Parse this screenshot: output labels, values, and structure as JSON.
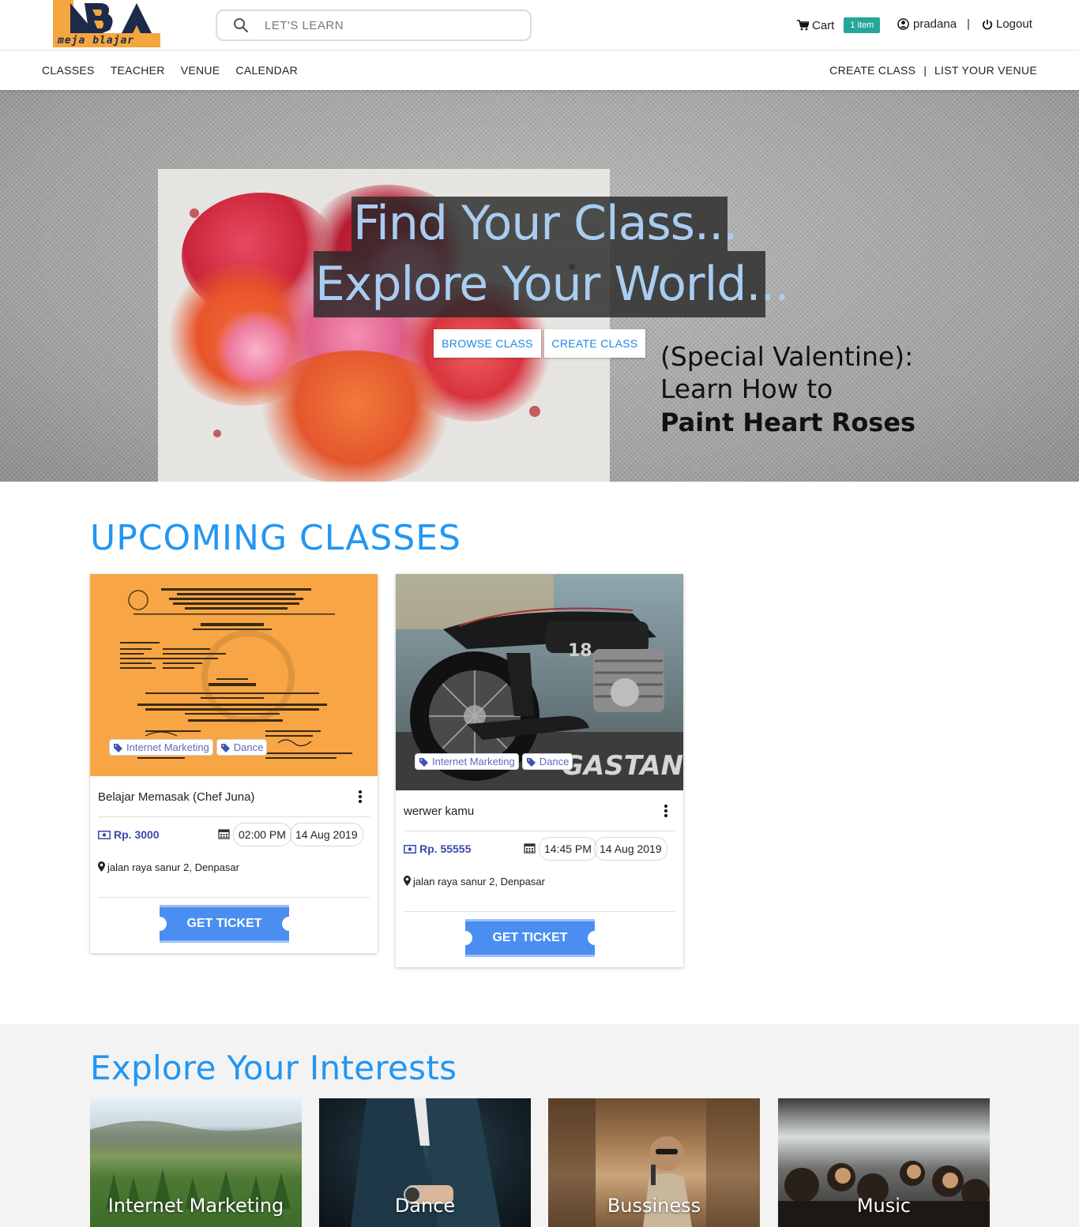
{
  "brand": {
    "logo_text": "meja blajar",
    "accent": "#f4a640",
    "navy": "#1d2a4a"
  },
  "search": {
    "placeholder": "LET'S LEARN"
  },
  "header": {
    "cart_label": "Cart",
    "cart_badge": "1 item",
    "username": "pradana",
    "separator": "|",
    "logout_label": "Logout"
  },
  "nav": {
    "left": [
      "CLASSES",
      "TEACHER",
      "VENUE",
      "CALENDAR"
    ],
    "right": [
      "CREATE CLASS",
      "LIST YOUR VENUE"
    ],
    "separator": "|"
  },
  "hero": {
    "line1": "Find Your Class...",
    "line2": "Explore Your World...",
    "browse_button": "BROWSE CLASS",
    "create_button": "CREATE CLASS",
    "promo_line1": "(Special Valentine):",
    "promo_line2": "Learn How to",
    "promo_line3": "Paint Heart Roses"
  },
  "upcoming": {
    "title": "UPCOMING CLASSES",
    "cards": [
      {
        "title": "Belajar Memasak (Chef Juna)",
        "tags": [
          "Internet Marketing",
          "Dance"
        ],
        "price": "Rp. 3000",
        "time": "02:00 PM",
        "date": "14 Aug 2019",
        "location": "jalan raya sanur 2, Denpasar",
        "button": "GET TICKET"
      },
      {
        "title": "werwer kamu",
        "tags": [
          "Internet Marketing",
          "Dance"
        ],
        "price": "Rp. 55555",
        "time": "14:45 PM",
        "date": "14 Aug 2019",
        "location": "jalan raya sanur 2, Denpasar",
        "button": "GET TICKET",
        "image_watermark": "GASTANK"
      }
    ]
  },
  "interests": {
    "title": "Explore Your Interests",
    "tiles": [
      "Internet Marketing",
      "Dance",
      "Bussiness",
      "Music"
    ]
  },
  "colors": {
    "primary_blue": "#2196f3",
    "ticket_blue": "#4a8ef2",
    "badge_teal": "#26a69a",
    "price_indigo": "#3949ab"
  }
}
